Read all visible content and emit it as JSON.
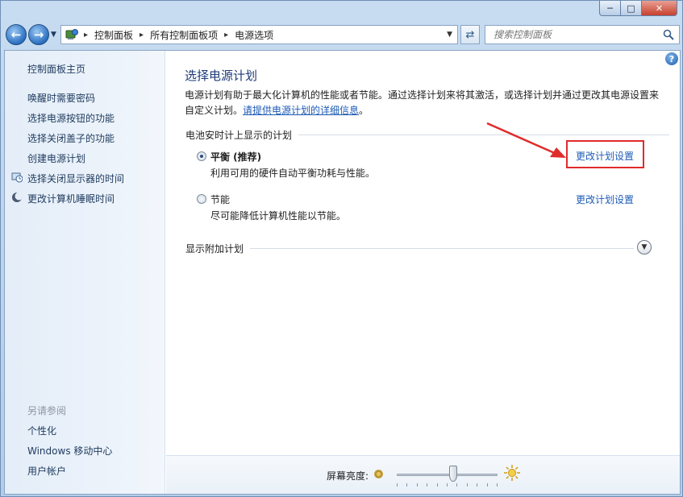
{
  "window": {
    "caption_min": "─",
    "caption_max": "□",
    "caption_close": "✕"
  },
  "navbar": {
    "back_icon": "back-arrow-icon",
    "forward_icon": "forward-arrow-icon",
    "breadcrumbs": [
      "控制面板",
      "所有控制面板项",
      "电源选项"
    ],
    "search_placeholder": "搜索控制面板"
  },
  "sidebar": {
    "home": "控制面板主页",
    "items": [
      {
        "label": "唤醒时需要密码",
        "icon": ""
      },
      {
        "label": "选择电源按钮的功能",
        "icon": ""
      },
      {
        "label": "选择关闭盖子的功能",
        "icon": ""
      },
      {
        "label": "创建电源计划",
        "icon": ""
      },
      {
        "label": "选择关闭显示器的时间",
        "icon": "monitor-clock-icon"
      },
      {
        "label": "更改计算机睡眠时间",
        "icon": "moon-icon"
      }
    ],
    "see_also_title": "另请参阅",
    "see_also": [
      "个性化",
      "Windows 移动中心",
      "用户帐户"
    ]
  },
  "main": {
    "title": "选择电源计划",
    "desc_text": "电源计划有助于最大化计算机的性能或者节能。通过选择计划来将其激活，或选择计划并通过更改其电源设置来自定义计划。",
    "desc_link": "请提供电源计划的详细信息",
    "desc_end": "。",
    "group_battery": "电池安时计上显示的计划",
    "plans": [
      {
        "name": "平衡 (推荐)",
        "desc": "利用可用的硬件自动平衡功耗与性能。",
        "link": "更改计划设置",
        "selected": true
      },
      {
        "name": "节能",
        "desc": "尽可能降低计算机性能以节能。",
        "link": "更改计划设置",
        "selected": false
      }
    ],
    "group_more": "显示附加计划"
  },
  "bottom": {
    "brightness_label": "屏幕亮度:",
    "brightness_fraction": 0.56
  },
  "colors": {
    "link": "#1e5bb5",
    "title": "#1e3a78",
    "highlight": "#e02b2b"
  }
}
